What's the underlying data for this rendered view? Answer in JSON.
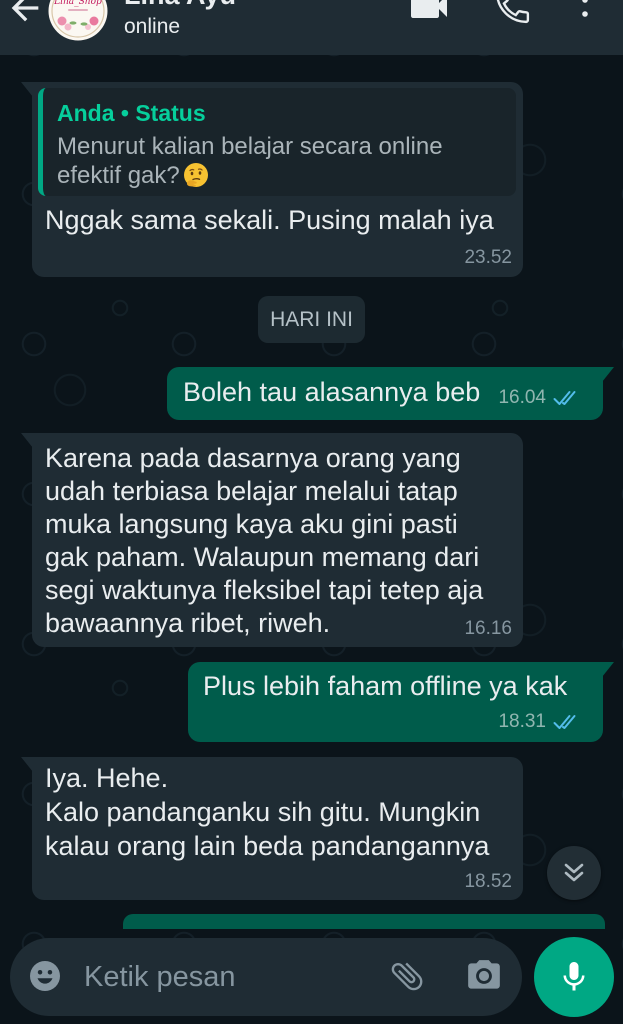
{
  "colors": {
    "chat_background": "#0b141a",
    "header_background": "#1f2c34",
    "incoming_bubble": "#1f2c34",
    "outgoing_bubble": "#005c4b",
    "accent_green": "#00a884",
    "quote_author": "#06cf9c",
    "read_receipt": "#53bdeb",
    "primary_text": "#e9edef",
    "secondary_text": "#8696a0"
  },
  "header": {
    "back_icon": "arrow-back-icon",
    "avatar_logo_text": "Lina_Shop",
    "contact_name": "Lina Ayu",
    "presence": "online",
    "video_call_icon": "video-call-icon",
    "voice_call_icon": "phone-icon",
    "menu_icon": "more-vertical-icon"
  },
  "chat": {
    "date_divider": "HARI INI",
    "messages": [
      {
        "quote": {
          "title": "Anda • Status",
          "lines": [
            "Menurut kalian belajar secara online",
            "efektif gak?"
          ],
          "emoji": "thinking-face-emoji"
        },
        "lines": [
          "Nggak sama sekali. Pusing malah iya"
        ],
        "time": "23.52"
      },
      {
        "lines": [
          "Boleh tau alasannya beb"
        ],
        "time": "16.04",
        "status_icon": "double-check-icon"
      },
      {
        "lines": [
          "Karena pada dasarnya orang yang",
          "udah terbiasa belajar melalui tatap",
          "muka langsung kaya aku gini pasti",
          "gak paham. Walaupun memang dari",
          "segi waktunya fleksibel tapi tetep aja",
          "bawaannya ribet, riweh."
        ],
        "time": "16.16"
      },
      {
        "lines": [
          "Plus lebih faham offline ya kak"
        ],
        "time": "18.31",
        "status_icon": "double-check-icon"
      },
      {
        "lines": [
          "Iya. Hehe.",
          "Kalo pandanganku sih gitu. Mungkin",
          "kalau orang lain beda pandangannya"
        ],
        "time": "18.52"
      }
    ]
  },
  "scroll_to_bottom": {
    "icon": "double-chevron-down-icon"
  },
  "composer": {
    "emoji_icon": "emoji-icon",
    "placeholder": "Ketik pesan",
    "attach_icon": "paperclip-icon",
    "camera_icon": "camera-icon",
    "voice_note_icon": "microphone-icon"
  }
}
